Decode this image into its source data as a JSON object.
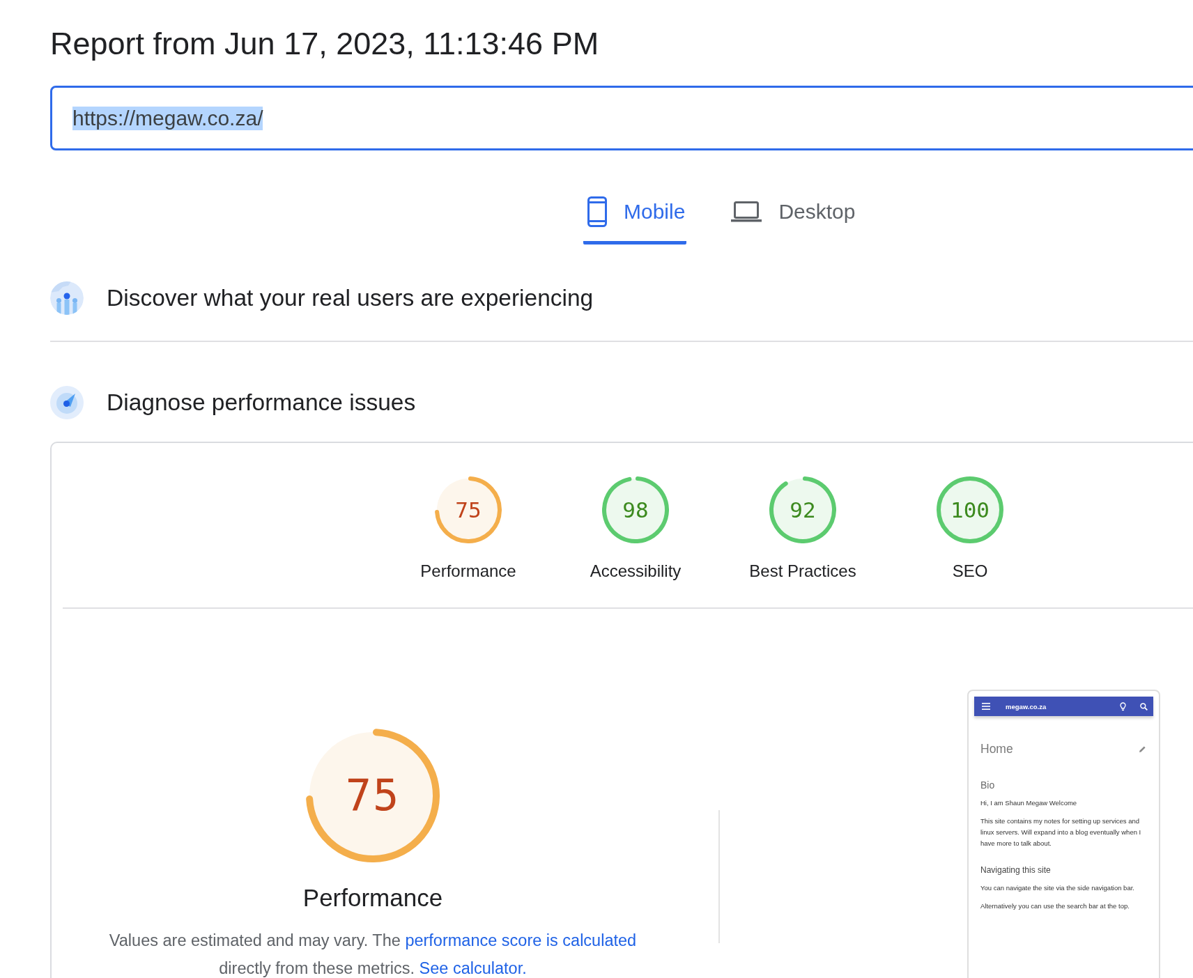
{
  "report": {
    "title": "Report from Jun 17, 2023, 11:13:46 PM"
  },
  "url_field": {
    "value": "https://megaw.co.za/",
    "focused": true,
    "text_selected": true
  },
  "tabs": [
    {
      "label": "Mobile",
      "selected": true
    },
    {
      "label": "Desktop",
      "selected": false
    }
  ],
  "sections": [
    {
      "title": "Discover what your real users are experiencing"
    },
    {
      "title": "Diagnose performance issues"
    }
  ],
  "categories": [
    {
      "score": "75",
      "label": "Performance"
    },
    {
      "score": "98",
      "label": "Accessibility"
    },
    {
      "score": "92",
      "label": "Best Practices"
    },
    {
      "score": "100",
      "label": "SEO"
    }
  ],
  "performance": {
    "score": "75",
    "title": "Performance",
    "note": [
      {
        "kind": "text",
        "text": "Values are estimated and may vary. The "
      },
      {
        "kind": "link",
        "text": "performance score is calculated"
      },
      {
        "kind": "text",
        "text": " directly from these metrics. "
      },
      {
        "kind": "link",
        "text": "See calculator."
      }
    ]
  },
  "screenshot": {
    "site_title": "megaw.co.za",
    "page_title": "Home",
    "blocks": [
      {
        "kind": "heading",
        "text": "Bio"
      },
      {
        "kind": "paragraph",
        "text": "Hi, I am Shaun Megaw Welcome"
      },
      {
        "kind": "paragraph",
        "text": "This site contains my notes for setting up services and linux servers. Will expand into a blog eventually when I have more to talk about."
      },
      {
        "kind": "subheading",
        "text": "Navigating this site"
      },
      {
        "kind": "paragraph",
        "text": "You can navigate the site via the side navigation bar."
      },
      {
        "kind": "paragraph",
        "text": "Alternatively you can use the search bar at the top."
      }
    ]
  }
}
